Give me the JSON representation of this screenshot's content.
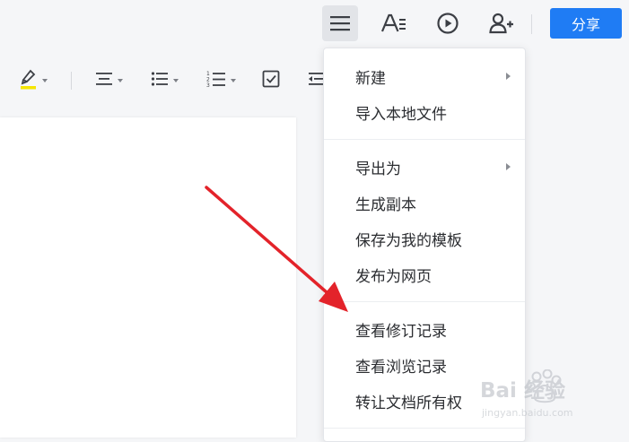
{
  "header": {
    "icons": [
      "menu-icon",
      "text-format-icon",
      "play-icon",
      "add-user-icon"
    ],
    "share_label": "分享",
    "accent_color": "#1f7cf4"
  },
  "toolbar": {
    "icons": [
      "highlighter-icon",
      "align-center-icon",
      "bullet-list-icon",
      "numbered-list-icon",
      "checkbox-icon",
      "outdent-icon"
    ],
    "highlight_color": "#f5e500"
  },
  "menu": {
    "groups": [
      {
        "items": [
          {
            "label": "新建",
            "has_submenu": true
          },
          {
            "label": "导入本地文件",
            "has_submenu": false
          }
        ]
      },
      {
        "items": [
          {
            "label": "导出为",
            "has_submenu": true
          },
          {
            "label": "生成副本",
            "has_submenu": false
          },
          {
            "label": "保存为我的模板",
            "has_submenu": false
          },
          {
            "label": "发布为网页",
            "has_submenu": false
          }
        ]
      },
      {
        "items": [
          {
            "label": "查看修订记录",
            "has_submenu": false
          },
          {
            "label": "查看浏览记录",
            "has_submenu": false
          },
          {
            "label": "转让文档所有权",
            "has_submenu": false
          }
        ]
      }
    ]
  },
  "annotation": {
    "color": "#e3232a"
  },
  "watermark": {
    "main": "Bai 经验",
    "sub": "jingyan.baidu.com"
  }
}
